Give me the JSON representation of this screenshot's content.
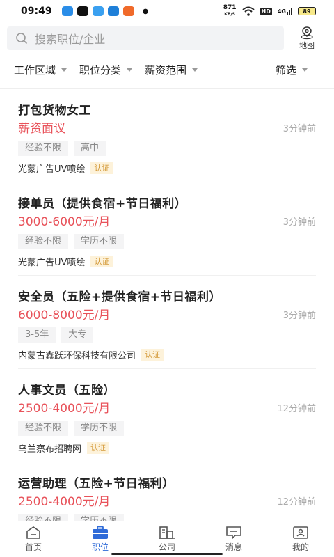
{
  "status_bar": {
    "time": "09:49",
    "net_speed_value": "871",
    "net_speed_unit": "KB/S",
    "hd_label": "HD",
    "signal_label": "4G",
    "battery": "89"
  },
  "search": {
    "placeholder": "搜索职位/企业",
    "map_label": "地图"
  },
  "filters": [
    {
      "label": "工作区域"
    },
    {
      "label": "职位分类"
    },
    {
      "label": "薪资范围"
    },
    {
      "label": "筛选"
    }
  ],
  "jobs": [
    {
      "title": "打包货物女工",
      "salary": "薪资面议",
      "time": "3分钟前",
      "tags": [
        "经验不限",
        "高中"
      ],
      "company": "光蒙广告UV喷绘",
      "cert": "认证"
    },
    {
      "title": "接单员（提供食宿+节日福利）",
      "salary": "3000-6000元/月",
      "time": "3分钟前",
      "tags": [
        "经验不限",
        "学历不限"
      ],
      "company": "光蒙广告UV喷绘",
      "cert": "认证"
    },
    {
      "title": "安全员（五险+提供食宿+节日福利）",
      "salary": "6000-8000元/月",
      "time": "3分钟前",
      "tags": [
        "3-5年",
        "大专"
      ],
      "company": "内蒙古鑫跃环保科技有限公司",
      "cert": "认证"
    },
    {
      "title": "人事文员（五险）",
      "salary": "2500-4000元/月",
      "time": "12分钟前",
      "tags": [
        "经验不限",
        "学历不限"
      ],
      "company": "乌兰察布招聘网",
      "cert": "认证"
    },
    {
      "title": "运营助理（五险+节日福利）",
      "salary": "2500-4000元/月",
      "time": "12分钟前",
      "tags": [
        "经验不限",
        "学历不限"
      ],
      "company": "",
      "cert": ""
    }
  ],
  "nav": [
    {
      "label": "首页",
      "icon": "home-icon"
    },
    {
      "label": "职位",
      "icon": "briefcase-icon"
    },
    {
      "label": "公司",
      "icon": "building-icon"
    },
    {
      "label": "消息",
      "icon": "message-icon"
    },
    {
      "label": "我的",
      "icon": "profile-icon"
    }
  ],
  "colors": {
    "accent": "#2f6bd8",
    "salary": "#e8525a",
    "cert_bg": "#fdf2da",
    "cert_text": "#d49a3a"
  }
}
